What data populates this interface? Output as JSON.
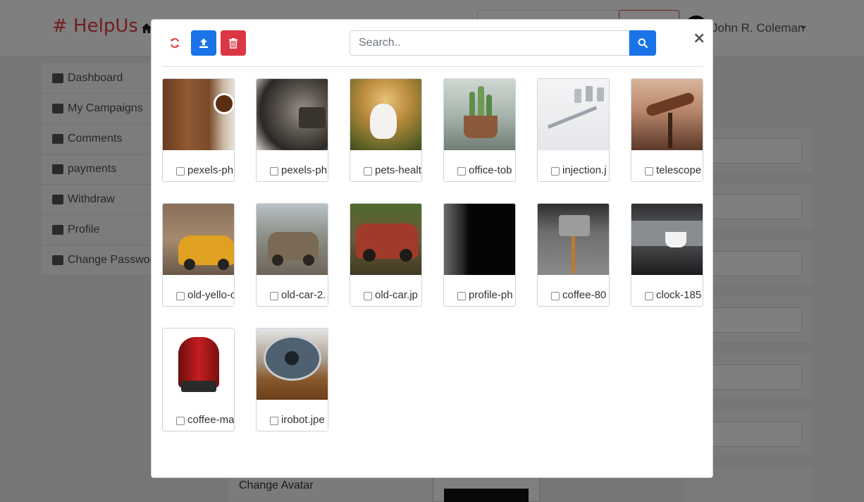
{
  "background": {
    "brand": "# HelpUs",
    "user_name": "John R. Coleman",
    "sidebar": [
      {
        "label": "Dashboard",
        "icon": "dashboard-icon"
      },
      {
        "label": "My Campaigns",
        "icon": "bullhorn-icon"
      },
      {
        "label": "Comments",
        "icon": "comment-icon"
      },
      {
        "label": "payments",
        "icon": "money-icon"
      },
      {
        "label": "Withdraw",
        "icon": "credit-card-icon"
      },
      {
        "label": "Profile",
        "icon": "user-icon"
      },
      {
        "label": "Change Password",
        "icon": "lock-icon"
      }
    ],
    "change_avatar_label": "Change Avatar"
  },
  "modal": {
    "search_placeholder": "Search..",
    "close_label": "×",
    "icons": {
      "refresh": "refresh-icon",
      "upload": "upload-icon",
      "delete": "trash-icon",
      "search": "search-icon"
    },
    "colors": {
      "primary": "#1a73e8",
      "danger": "#dc3545",
      "brand": "#e03c3c"
    },
    "files": [
      {
        "name": "pexels-ph",
        "checked": false
      },
      {
        "name": "pexels-ph",
        "checked": false
      },
      {
        "name": "pets-healt",
        "checked": false
      },
      {
        "name": "office-tob",
        "checked": false
      },
      {
        "name": "injection.j",
        "checked": false
      },
      {
        "name": "telescope",
        "checked": false
      },
      {
        "name": "old-yello-c",
        "checked": false
      },
      {
        "name": "old-car-2.",
        "checked": false
      },
      {
        "name": "old-car.jp",
        "checked": false
      },
      {
        "name": "profile-ph",
        "checked": false
      },
      {
        "name": "coffee-80",
        "checked": false
      },
      {
        "name": "clock-185",
        "checked": false
      },
      {
        "name": "coffee-ma",
        "checked": false
      },
      {
        "name": "irobot.jpe",
        "checked": false
      }
    ]
  }
}
